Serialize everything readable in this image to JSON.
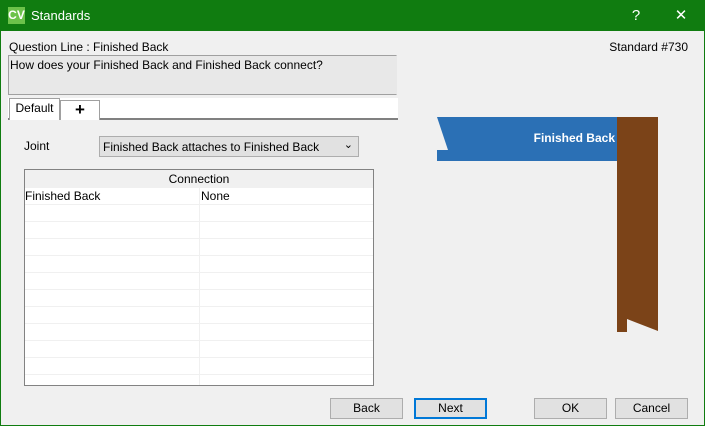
{
  "window": {
    "title": "Standards",
    "logo": "CV",
    "help": "?",
    "close": "✕"
  },
  "question_line_label": "Question Line : Finished Back",
  "standard_label": "Standard #730",
  "question_text": "How does your Finished Back and Finished Back connect?",
  "tabs": [
    {
      "label": "Default"
    },
    {
      "label": "+"
    }
  ],
  "joint": {
    "label": "Joint",
    "value": "Finished Back attaches to Finished Back"
  },
  "grid": {
    "header": "Connection",
    "rows": [
      {
        "name": "Finished Back",
        "value": "None"
      }
    ]
  },
  "diagram": {
    "label": "Finished Back",
    "colors": {
      "blue": "#2b70b5",
      "brown": "#7b4318"
    }
  },
  "buttons": {
    "back": "Back",
    "next": "Next",
    "ok": "OK",
    "cancel": "Cancel"
  }
}
